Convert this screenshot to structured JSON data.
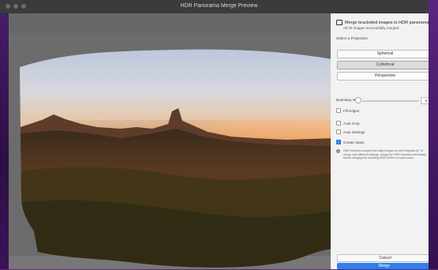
{
  "window": {
    "title": "HDR Panorama Merge Preview"
  },
  "panel": {
    "header_title": "Merge bracketed images to HDR panorama",
    "header_sub": "All 20 images successfully merged",
    "section_label": "Select a Projection",
    "projections": [
      {
        "label": "Spherical",
        "selected": false
      },
      {
        "label": "Cylindrical",
        "selected": true
      },
      {
        "label": "Perspective",
        "selected": false
      }
    ],
    "boundary_warp": {
      "label": "Boundary Warp",
      "value": "0"
    },
    "fill_edges": {
      "label": "Fill Edges",
      "checked": false
    },
    "auto_crop": {
      "label": "Auto Crop",
      "checked": false
    },
    "auto_settings": {
      "label": "Auto Settings",
      "checked": false
    },
    "create_stack": {
      "label": "Create Stack",
      "checked": true
    },
    "info_text": "HDR brackets merged with align images on and Deghost off. To merge with different settings, merge the HDR brackets individually before merging the resulting HDR DNGs to a panorama.",
    "cancel_label": "Cancel",
    "merge_label": "Merge"
  },
  "colors": {
    "accent": "#2f7ff0",
    "panel_bg": "#f2f2f2",
    "preview_bg": "#6c6c6c"
  }
}
